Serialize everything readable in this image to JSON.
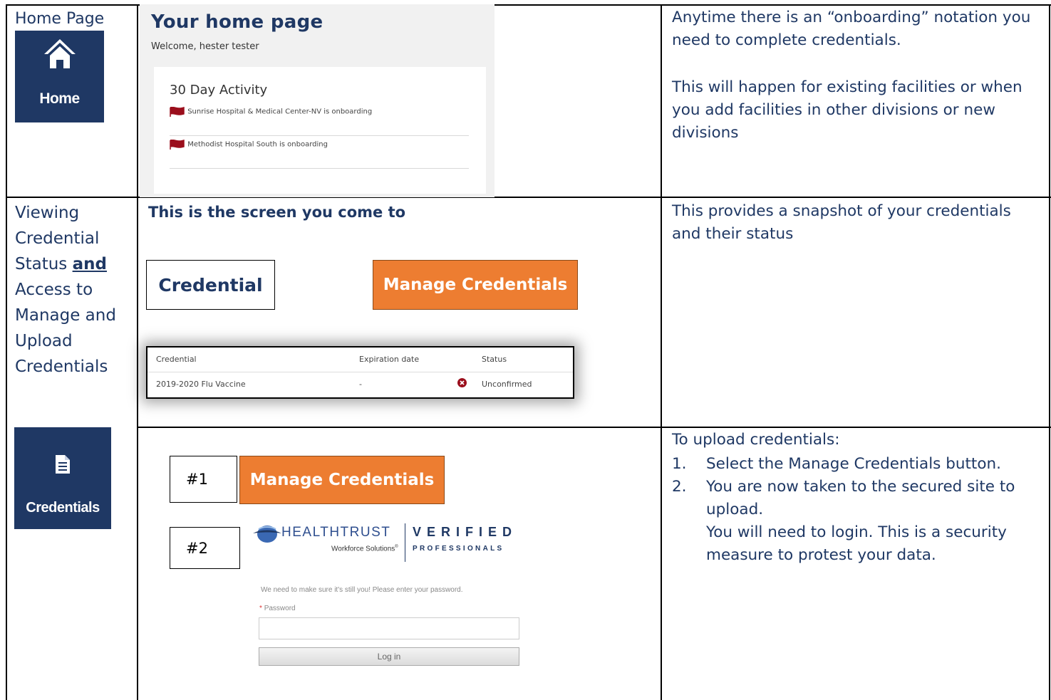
{
  "home_row": {
    "label": "Home Page",
    "nav_tile_label": "Home",
    "screenshot": {
      "title": "Your home page",
      "welcome": "Welcome, hester tester",
      "card_title": "30 Day Activity",
      "activities": [
        "Sunrise Hospital & Medical Center-NV is onboarding",
        "Methodist Hospital South is onboarding"
      ]
    },
    "note_1": "Anytime there is an “onboarding” notation you need to complete credentials.",
    "note_2": "This will happen for existing facilities or when you add facilities in other divisions or new divisions"
  },
  "cred_row": {
    "label_part1": "Viewing Credential Status ",
    "label_bold": "and",
    "label_part2": " Access to Manage and Upload Credentials",
    "nav_tile_label": "Credentials",
    "screen_heading": "This is the screen you come to",
    "credential_box": "Credential",
    "manage_button": "Manage Credentials",
    "table": {
      "headers": [
        "Credential",
        "Expiration date",
        "Status"
      ],
      "rows": [
        {
          "credential": "2019-2020 Flu Vaccine",
          "expiration": "-",
          "status": "Unconfirmed"
        }
      ]
    },
    "note": "This provides a snapshot of your credentials and their status"
  },
  "upload_row": {
    "step1_tag": "#1",
    "step2_tag": "#2",
    "manage_button": "Manage Credentials",
    "logo": {
      "left_name": "HEALTHTRUST",
      "left_sub": "Workforce Solutions",
      "right_name": "VERIFIED",
      "right_sub": "PROFESSIONALS"
    },
    "login_message": "We need to make sure it's still you! Please enter your password.",
    "password_required_mark": "*",
    "password_label": "Password",
    "password_value": "",
    "login_button": "Log in",
    "intro": "To upload credentials:",
    "steps": [
      {
        "num": "1.",
        "text": "Select the Manage Credentials button."
      },
      {
        "num": "2.",
        "text": "You are now taken to the secured site to upload."
      }
    ],
    "step2_extra": "You will need to login.  This is a security measure to protest your data."
  },
  "colors": {
    "navy": "#1f3864",
    "orange": "#ed7d31",
    "flag_red": "#9b0e1c"
  }
}
